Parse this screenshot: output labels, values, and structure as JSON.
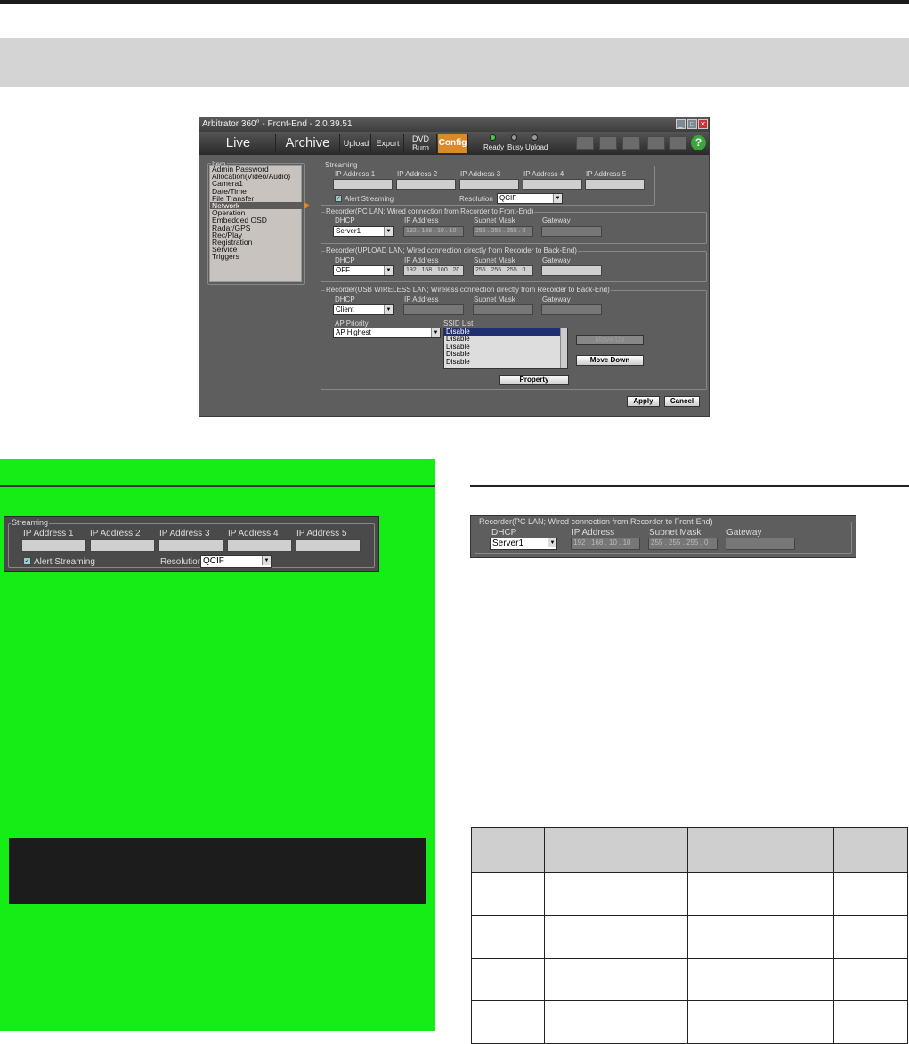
{
  "window": {
    "title": "Arbitrator 360° - Front-End - 2.0.39.51",
    "toolbar": {
      "live": "Live",
      "archive": "Archive",
      "upload": "Upload",
      "export": "Export",
      "dvd_line1": "DVD",
      "dvd_line2": "Burn",
      "config": "Config",
      "status": {
        "ready": "Ready",
        "busy": "Busy",
        "upload": "Upload"
      },
      "help": "?"
    },
    "item_list": {
      "label": "Item",
      "items": [
        "Admin Password",
        "Allocation(Video/Audio)",
        "Camera1",
        "Date/Time",
        "File Transfer",
        "Network",
        "Operation",
        "Embedded OSD",
        "Radar/GPS",
        "Rec/Play",
        "Registration",
        "Service",
        "Triggers"
      ],
      "selected": "Network"
    },
    "streaming": {
      "label": "Streaming",
      "ip_labels": [
        "IP Address 1",
        "IP Address 2",
        "IP Address 3",
        "IP Address 4",
        "IP Address 5"
      ],
      "alert_label": "Alert Streaming",
      "alert_checked": true,
      "resolution_label": "Resolution",
      "resolution_value": "QCIF"
    },
    "pc_lan": {
      "label": "Recorder(PC LAN; Wired connection from Recorder to Front-End)",
      "dhcp_label": "DHCP",
      "dhcp_value": "Server1",
      "ip_label": "IP Address",
      "ip_value": "192 . 168 .  10  .  10",
      "mask_label": "Subnet Mask",
      "mask_value": "255 . 255 . 255 .  0",
      "gateway_label": "Gateway"
    },
    "upload_lan": {
      "label": "Recorder(UPLOAD LAN; Wired connection directly from Recorder to Back-End)",
      "dhcp_label": "DHCP",
      "dhcp_value": "OFF",
      "ip_label": "IP Address",
      "ip_value": "192 . 168 . 100 .  20",
      "mask_label": "Subnet Mask",
      "mask_value": "255 . 255 . 255 .  0",
      "gateway_label": "Gateway"
    },
    "usb_wlan": {
      "label": "Recorder(USB WIRELESS LAN; Wireless connection directly from Recorder to Back-End)",
      "dhcp_label": "DHCP",
      "dhcp_value": "Client",
      "ip_label": "IP Address",
      "mask_label": "Subnet Mask",
      "gateway_label": "Gateway",
      "ap_priority_label": "AP Priority",
      "ap_priority_value": "AP Highest",
      "ssid_label": "SSID List",
      "ssid_items": [
        "Disable",
        "Disable",
        "Disable",
        "Disable",
        "Disable"
      ],
      "move_up": "Move Up",
      "move_down": "Move Down",
      "property": "Property"
    },
    "apply": "Apply",
    "cancel": "Cancel"
  },
  "green_panel": {
    "streaming": {
      "label": "Streaming",
      "ip_labels": [
        "IP Address 1",
        "IP Address 2",
        "IP Address 3",
        "IP Address 4",
        "IP Address 5"
      ],
      "alert_label": "Alert Streaming",
      "resolution_label": "Resolution",
      "resolution_value": "QCIF"
    }
  },
  "right_panel": {
    "label": "Recorder(PC LAN; Wired connection from Recorder to Front-End)",
    "dhcp_label": "DHCP",
    "dhcp_value": "Server1",
    "ip_label": "IP Address",
    "ip_value": "192 . 168 .  10  .  10",
    "mask_label": "Subnet Mask",
    "mask_value": "255 . 255 . 255 .  0",
    "gateway_label": "Gateway"
  },
  "colors": {
    "accent": "#d98a2a",
    "highlight_green": "#16ec16"
  }
}
